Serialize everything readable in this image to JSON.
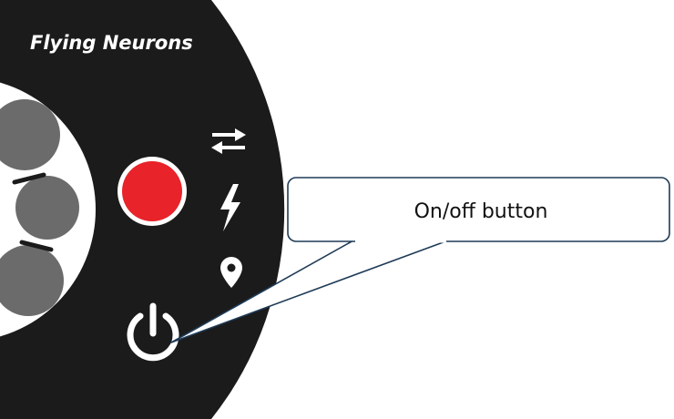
{
  "device": {
    "brand": "Flying Neurons",
    "record_indicator_color": "#e8232a",
    "body_color": "#1b1b1b",
    "ring_button_color": "#6b6b6b",
    "icons": [
      "transfer-arrows-icon",
      "lightning-icon",
      "location-pin-icon",
      "power-icon"
    ]
  },
  "callout": {
    "label": "On/off button",
    "border_color": "#1f3b57"
  }
}
